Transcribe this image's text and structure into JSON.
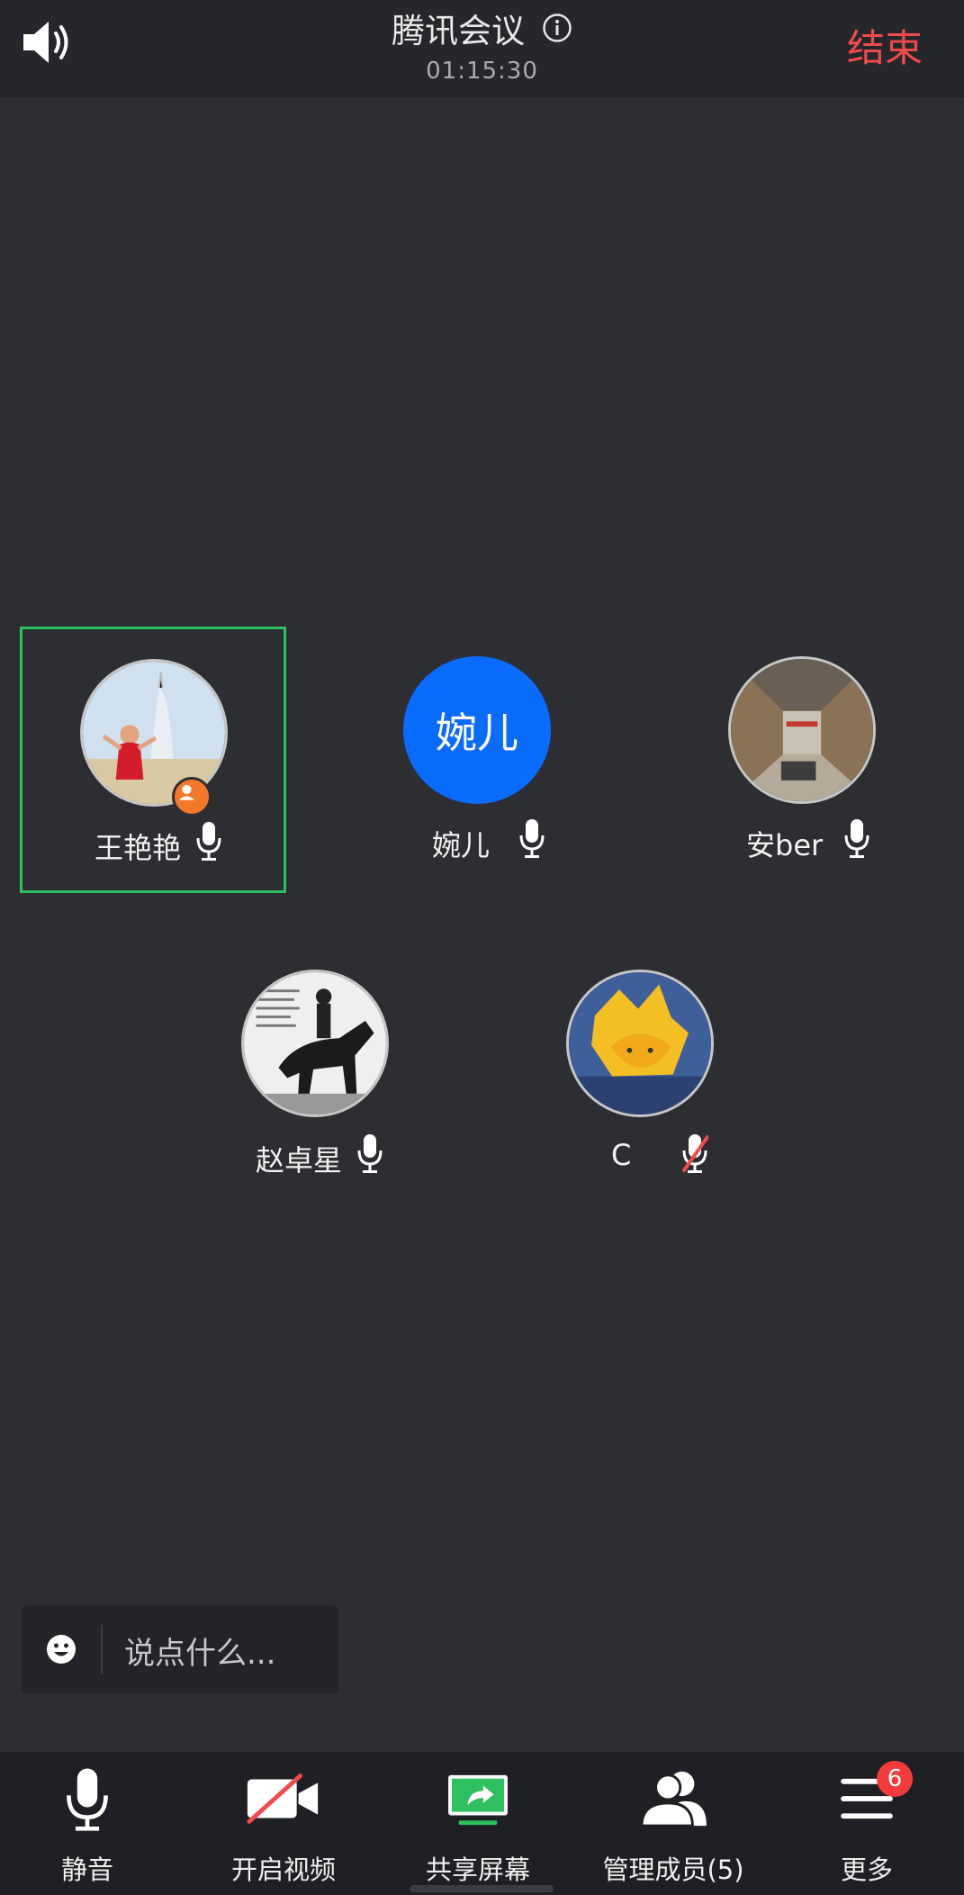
{
  "header": {
    "title": "腾讯会议",
    "timer": "01:15:30",
    "end_label": "结束"
  },
  "participants": [
    {
      "name": "王艳艳",
      "mic": "on",
      "host": true,
      "active_speaker": true,
      "avatar": "photo-burj-al-arab"
    },
    {
      "name": "婉儿",
      "mic": "on",
      "host": false,
      "active_speaker": false,
      "avatar": "initials",
      "avatar_text": "婉儿",
      "avatar_color": "#0a6cff"
    },
    {
      "name": "安ber",
      "mic": "on",
      "host": false,
      "active_speaker": false,
      "avatar": "photo-warehouse"
    },
    {
      "name": "赵卓星",
      "mic": "on",
      "host": false,
      "active_speaker": false,
      "avatar": "photo-horse-rider"
    },
    {
      "name": "C",
      "mic": "muted",
      "host": false,
      "active_speaker": false,
      "avatar": "illustration-yellow-hat"
    }
  ],
  "chat": {
    "placeholder": "说点什么..."
  },
  "toolbar": {
    "mute_label": "静音",
    "video_label": "开启视频",
    "share_label": "共享屏幕",
    "members_label": "管理成员(5)",
    "more_label": "更多",
    "more_badge": "6"
  },
  "colors": {
    "accent_green": "#2ec05e",
    "end_red": "#f24a4a",
    "background": "#2c2e31"
  }
}
